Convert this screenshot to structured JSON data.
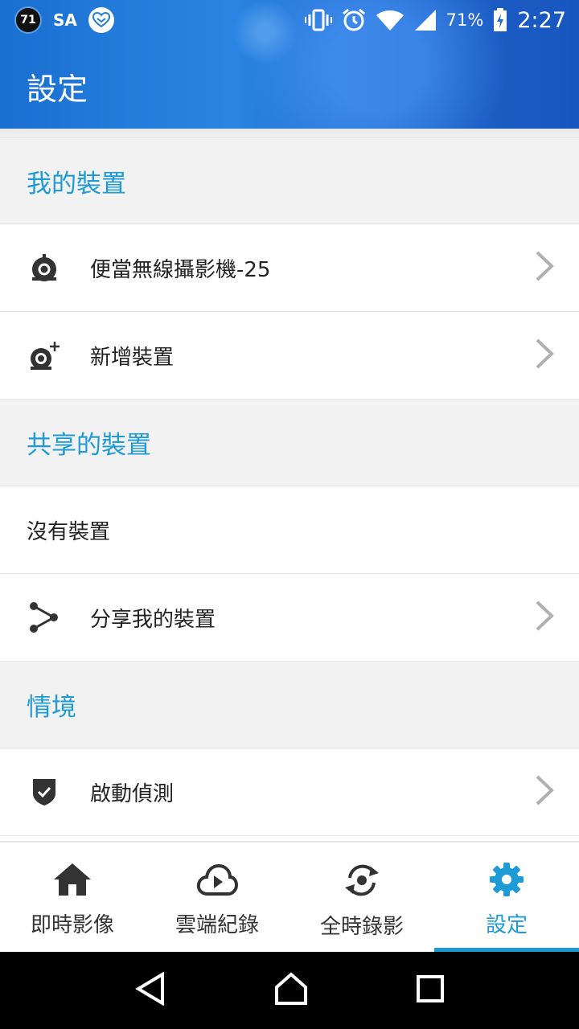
{
  "status_bar": {
    "notification_count": "71",
    "carrier_text": "SA",
    "battery_percent": "71%",
    "time": "2:27"
  },
  "app_bar": {
    "title": "設定"
  },
  "sections": {
    "my_devices": {
      "title": "我的裝置",
      "items": [
        {
          "label": "便當無線攝影機-25",
          "icon": "camera-icon"
        },
        {
          "label": "新增裝置",
          "icon": "add-camera-icon"
        }
      ]
    },
    "shared_devices": {
      "title": "共享的裝置",
      "empty_text": "沒有裝置",
      "share_label": "分享我的裝置"
    },
    "scenarios": {
      "title": "情境",
      "items": [
        {
          "label": "啟動偵測",
          "icon": "shield-check-icon"
        }
      ]
    }
  },
  "bottom_nav": {
    "items": [
      {
        "label": "即時影像",
        "icon": "home-icon"
      },
      {
        "label": "雲端紀錄",
        "icon": "cloud-play-icon"
      },
      {
        "label": "全時錄影",
        "icon": "rotate-record-icon"
      },
      {
        "label": "設定",
        "icon": "gear-icon"
      }
    ],
    "active_index": 3
  },
  "colors": {
    "accent": "#1e9ad6",
    "header_blue": "#1f6fd2",
    "section_bg": "#f2f2f2",
    "icon_dark": "#333333"
  }
}
